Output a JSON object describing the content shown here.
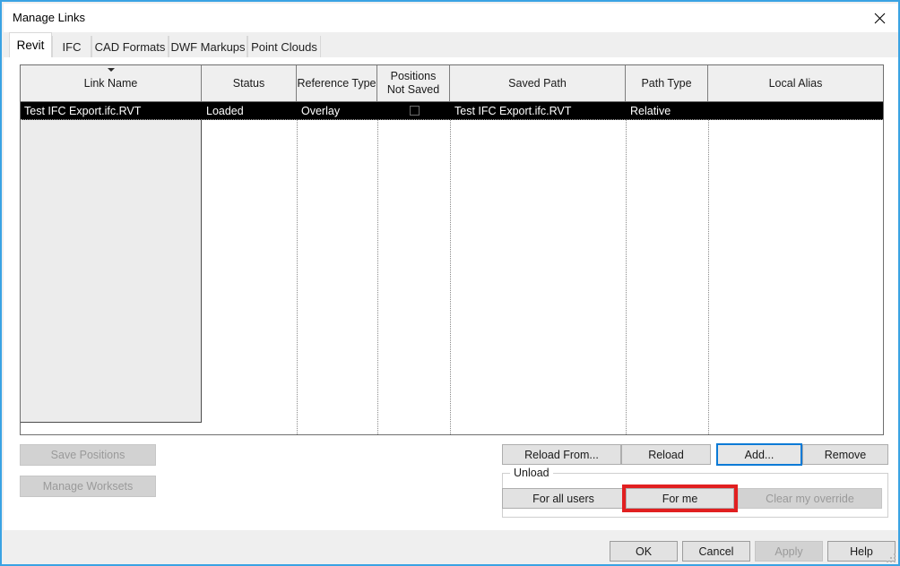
{
  "window": {
    "title": "Manage Links",
    "close_icon": "close-icon"
  },
  "tabs": [
    {
      "label": "Revit",
      "active": true
    },
    {
      "label": "IFC",
      "active": false
    },
    {
      "label": "CAD Formats",
      "active": false
    },
    {
      "label": "DWF Markups",
      "active": false
    },
    {
      "label": "Point Clouds",
      "active": false
    }
  ],
  "grid": {
    "sort_indicator": "sort-descending-arrow-icon",
    "columns": [
      {
        "label": "Link Name"
      },
      {
        "label": "Status"
      },
      {
        "label": "Reference Type"
      },
      {
        "label": "Positions\nNot Saved"
      },
      {
        "label": "Saved Path"
      },
      {
        "label": "Path Type"
      },
      {
        "label": "Local Alias"
      }
    ],
    "column_headers": {
      "link_name": "Link Name",
      "status": "Status",
      "reference_type": "Reference Type",
      "positions_not_saved_line1": "Positions",
      "positions_not_saved_line2": "Not Saved",
      "saved_path": "Saved Path",
      "path_type": "Path Type",
      "local_alias": "Local Alias"
    },
    "rows": [
      {
        "link_name": "Test IFC Export.ifc.RVT",
        "status": "Loaded",
        "reference_type": "Overlay",
        "positions_not_saved": false,
        "saved_path": "Test IFC Export.ifc.RVT",
        "path_type": "Relative",
        "local_alias": "",
        "selected": true
      }
    ]
  },
  "left_buttons": {
    "save_positions": "Save Positions",
    "manage_worksets": "Manage Worksets"
  },
  "action_buttons": {
    "reload_from": "Reload From...",
    "reload": "Reload",
    "add": "Add...",
    "remove": "Remove"
  },
  "unload_group": {
    "legend": "Unload",
    "for_all_users": "For all users",
    "for_me": "For me",
    "clear_my_override": "Clear my override"
  },
  "footer_buttons": {
    "ok": "OK",
    "cancel": "Cancel",
    "apply": "Apply",
    "help": "Help"
  },
  "colors": {
    "window_border": "#3aa3e3",
    "selection_background": "#000000",
    "selection_text": "#ffffff",
    "focus_outline": "#0a7ad6",
    "annotation_highlight": "#e11f20",
    "dialog_background": "#efefef"
  }
}
